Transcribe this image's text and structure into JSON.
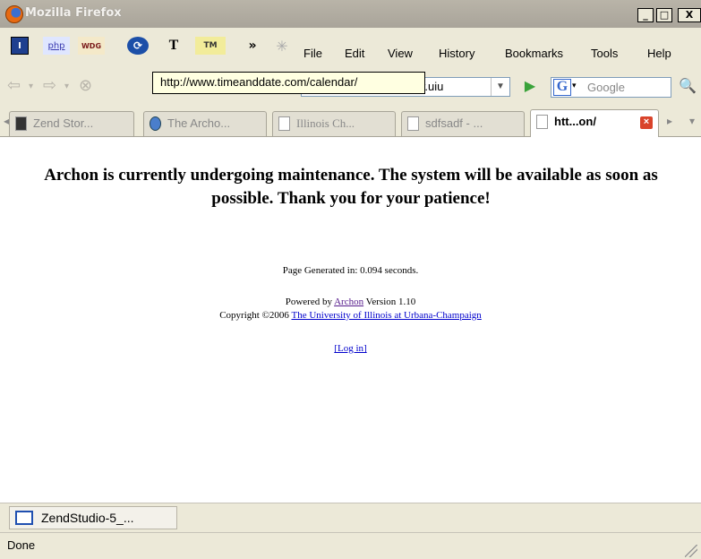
{
  "window": {
    "title": "Mozilla Firefox",
    "minimize_label": "_",
    "maximize_label": "□",
    "close_label": "X"
  },
  "bookmarks_toolbar": {
    "items": [
      "I",
      "php",
      "WDG",
      "T",
      "TM"
    ],
    "overflow_label": "»"
  },
  "menu": {
    "file": "File",
    "edit": "Edit",
    "view": "View",
    "history": "History",
    "bookmarks": "Bookmarks",
    "tools": "Tools",
    "help": "Help"
  },
  "navigation": {
    "url_visible_text": "rary.uiu",
    "search_placeholder": "Google"
  },
  "tooltip": {
    "text": "http://www.timeanddate.com/calendar/"
  },
  "tabs": [
    {
      "label": "Zend Stor..."
    },
    {
      "label": "The Archo..."
    },
    {
      "label": "Illinois Ch..."
    },
    {
      "label": "sdfsadf - ..."
    },
    {
      "label": "htt...on/",
      "active": true
    }
  ],
  "page": {
    "headline": "Archon is currently undergoing maintenance. The system will be available as soon as possible. Thank you for your patience!",
    "generated_text": "Page Generated in: 0.094 seconds.",
    "powered_prefix": "Powered by ",
    "powered_link": "Archon",
    "powered_suffix": " Version 1.10",
    "copyright_prefix": "Copyright ©2006 ",
    "copyright_link": "The University of Illinois at Urbana-Champaign",
    "login_link": "[Log in]"
  },
  "taskbar": {
    "item_label": "ZendStudio-5_..."
  },
  "status": {
    "text": "Done"
  },
  "colors": {
    "link": "#0000cc",
    "visited_link": "#551a8b",
    "tooltip_bg": "#ffffe1",
    "chrome_bg": "#ece9d8"
  }
}
